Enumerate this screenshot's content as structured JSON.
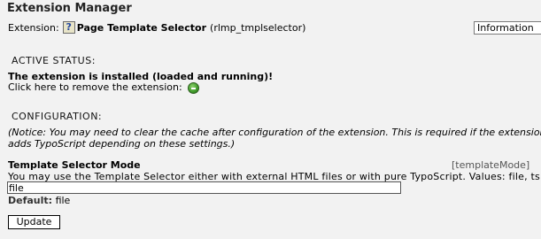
{
  "page": {
    "title": "Extension Manager"
  },
  "extension": {
    "label": "Extension:",
    "icon": "question-mark-icon",
    "name": "Page Template Selector",
    "key": "(rlmp_tmplselector)",
    "info_select_value": "Information"
  },
  "active_status": {
    "heading": "ACTIVE STATUS:",
    "status_text": "The extension is installed (loaded and running)!",
    "remove_text": "Click here to remove the extension:",
    "remove_icon": "remove-extension-icon"
  },
  "configuration": {
    "heading": "CONFIGURATION:",
    "notice": "(Notice: You may need to clear the cache after configuration of the extension. This is required if the extension adds TypoScript depending on these settings.)",
    "field": {
      "label": "Template Selector Mode",
      "key": "[templateMode]",
      "description": "You may use the Template Selector either with external HTML files or with pure TypoScript. Values: file, ts",
      "value": "file",
      "default_label": "Default:",
      "default_value": "file"
    },
    "update_label": "Update"
  },
  "colors": {
    "background": "#f2f2f2",
    "remove_icon_green": "#3f9a2a"
  }
}
